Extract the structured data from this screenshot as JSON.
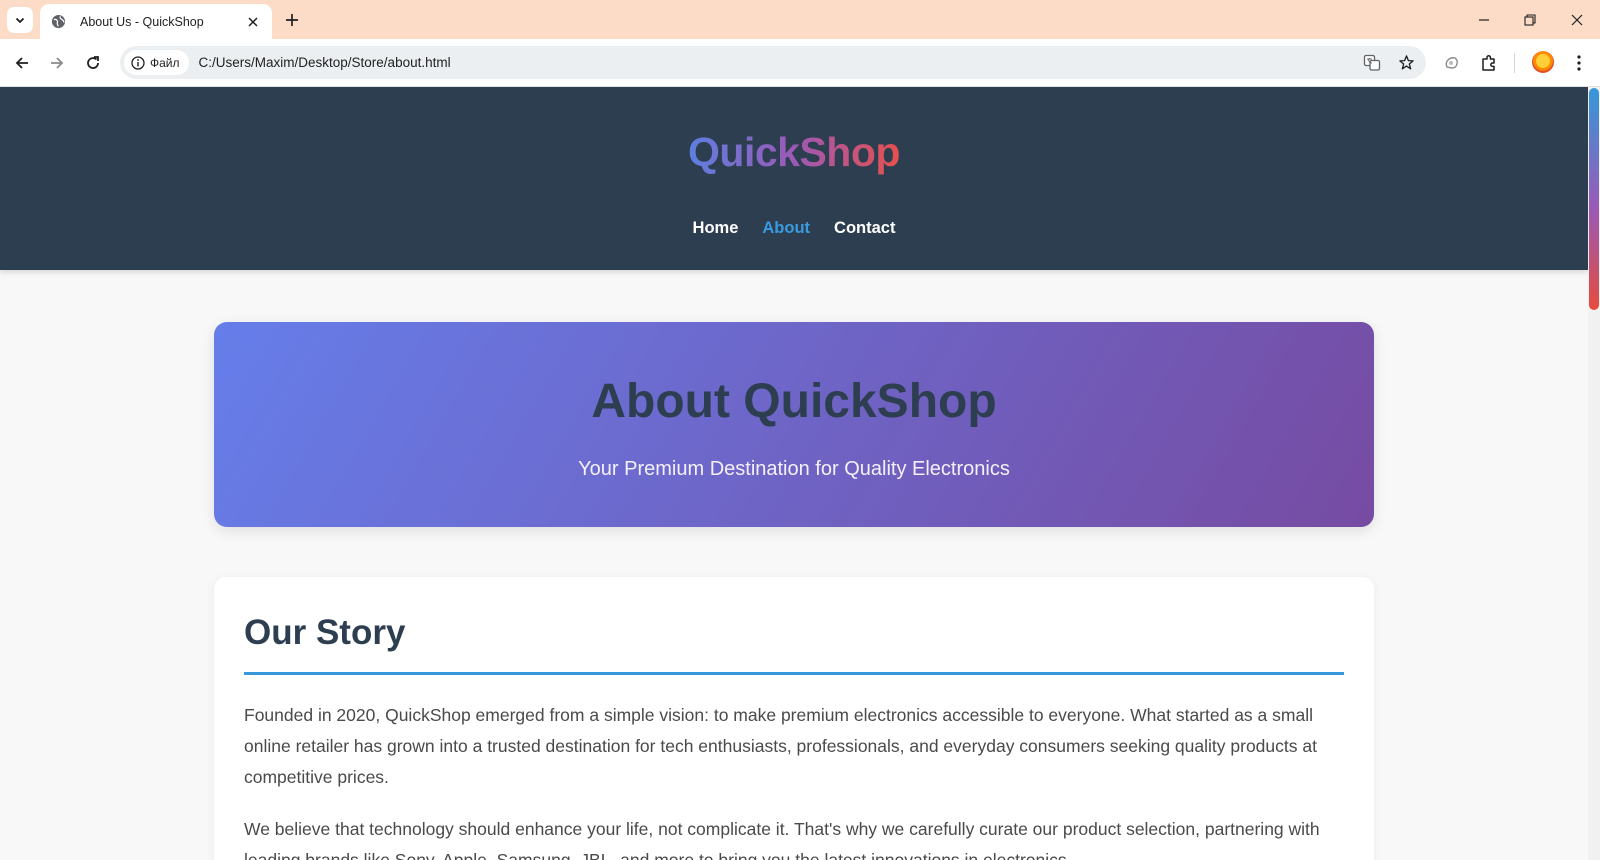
{
  "browser": {
    "tab_title": "About Us - QuickShop",
    "site_chip_label": "Файл",
    "url": "C:/Users/Maxim/Desktop/Store/about.html"
  },
  "site": {
    "logo": "QuickShop",
    "nav": [
      {
        "label": "Home",
        "active": false
      },
      {
        "label": "About",
        "active": true
      },
      {
        "label": "Contact",
        "active": false
      }
    ]
  },
  "hero": {
    "title": "About QuickShop",
    "subtitle": "Your Premium Destination for Quality Electronics"
  },
  "story": {
    "title": "Our Story",
    "paragraphs": [
      "Founded in 2020, QuickShop emerged from a simple vision: to make premium electronics accessible to everyone. What started as a small online retailer has grown into a trusted destination for tech enthusiasts, professionals, and everyday consumers seeking quality products at competitive prices.",
      "We believe that technology should enhance your life, not complicate it. That's why we carefully curate our product selection, partnering with leading brands like Sony, Apple, Samsung, JBL, and more to bring you the latest innovations in electronics."
    ]
  },
  "colors": {
    "header_bg": "#2d3e50",
    "nav_active": "#3a9be0",
    "hero_gradient_start": "#667eea",
    "hero_gradient_end": "#764ba2",
    "divider": "#3498db",
    "tabstrip_bg": "#fcdcc6"
  }
}
